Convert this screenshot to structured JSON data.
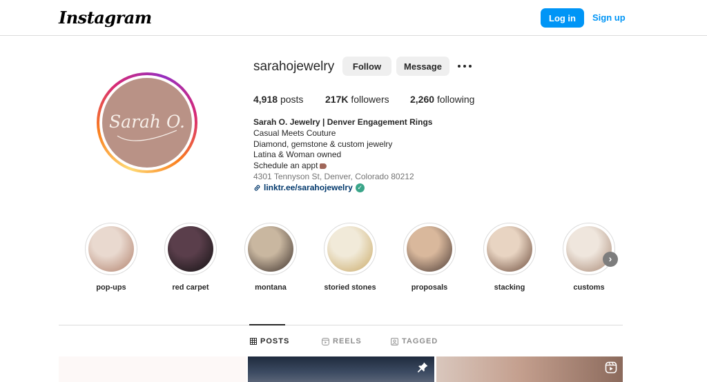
{
  "header": {
    "logo_text": "Instagram",
    "login_label": "Log in",
    "signup_label": "Sign up",
    "accent_color": "#0095f6"
  },
  "profile": {
    "username": "sarahojewelry",
    "follow_label": "Follow",
    "message_label": "Message",
    "more_icon": "more-horizontal-icon",
    "avatar_text": "Sarah O.",
    "stats": {
      "posts_count": "4,918",
      "posts_label": "posts",
      "followers_count": "217K",
      "followers_label": "followers",
      "following_count": "2,260",
      "following_label": "following"
    },
    "bio": {
      "name": "Sarah O. Jewelry | Denver Engagement Rings",
      "line1": "Casual Meets Couture",
      "line2": "Diamond, gemstone & custom jewelry",
      "line3": "Latina & Woman owned",
      "line4": "Schedule an appt",
      "address": "4301 Tennyson St, Denver, Colorado 80212",
      "link": "linktr.ee/sarahojewelry",
      "verified_color": "#3aa589"
    }
  },
  "highlights": [
    {
      "label": "pop-ups",
      "colors": [
        "#e9d9cf",
        "#b07f6a"
      ]
    },
    {
      "label": "red carpet",
      "colors": [
        "#5a3e4b",
        "#111111"
      ]
    },
    {
      "label": "montana",
      "colors": [
        "#c9b7a0",
        "#3b2f2a"
      ]
    },
    {
      "label": "storied stones",
      "colors": [
        "#f1ead9",
        "#c9a864"
      ]
    },
    {
      "label": "proposals",
      "colors": [
        "#d9b89c",
        "#4a3a35"
      ]
    },
    {
      "label": "stacking",
      "colors": [
        "#e8d4c2",
        "#6b4a3a"
      ]
    },
    {
      "label": "customs",
      "colors": [
        "#efe6dd",
        "#a88874"
      ]
    }
  ],
  "tabs": {
    "posts": "POSTS",
    "reels": "REELS",
    "tagged": "TAGGED"
  },
  "posts": [
    {
      "icon": "pin-icon"
    },
    {
      "icon": "reels-icon"
    }
  ]
}
